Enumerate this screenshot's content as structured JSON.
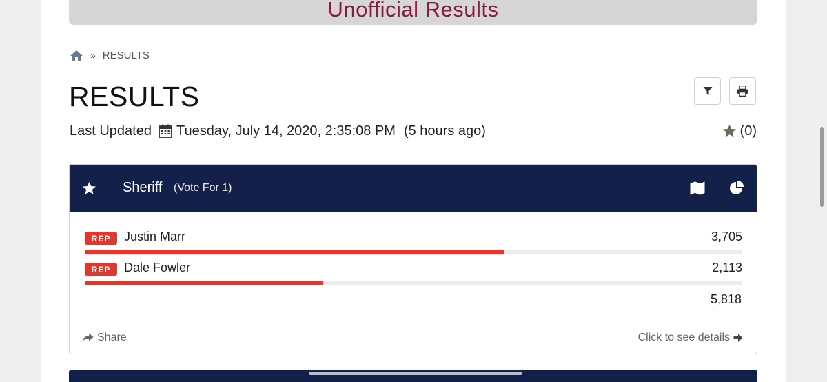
{
  "banner": {
    "title": "Unofficial Results"
  },
  "breadcrumb": {
    "separator": "»",
    "current": "RESULTS"
  },
  "page": {
    "title": "RESULTS"
  },
  "toolbar": {
    "filter_icon": "filter-icon",
    "print_icon": "print-icon"
  },
  "updated": {
    "label": "Last Updated",
    "datetime": "Tuesday, July 14, 2020, 2:35:08 PM",
    "relative": "(5 hours ago)"
  },
  "favorites": {
    "count_label": "(0)"
  },
  "race": {
    "name": "Sheriff",
    "vote_for": "(Vote For 1)",
    "candidates": [
      {
        "party": "REP",
        "name": "Justin Marr",
        "votes": "3,705",
        "share": 0.637
      },
      {
        "party": "REP",
        "name": "Dale Fowler",
        "votes": "2,113",
        "share": 0.363
      }
    ],
    "total": "5,818",
    "share_label": "Share",
    "details_label": "Click to see details"
  },
  "colors": {
    "header_bg": "#13204a",
    "party_rep": "#e0382f",
    "banner_text": "#8c1a3a"
  }
}
